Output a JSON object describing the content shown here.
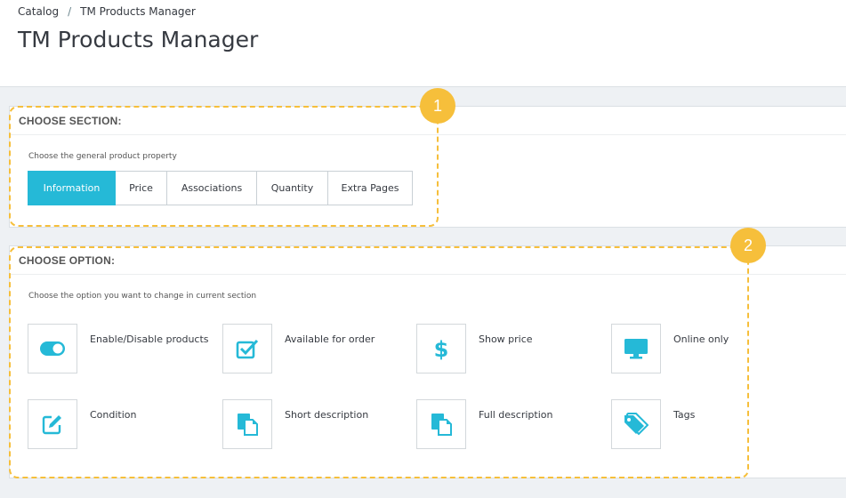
{
  "breadcrumb": {
    "root": "Catalog",
    "separator": "/",
    "current": "TM Products Manager"
  },
  "page_title": "TM Products Manager",
  "section_panel": {
    "heading": "CHOOSE SECTION:",
    "hint": "Choose the general product property",
    "buttons": [
      {
        "label": "Information",
        "active": true
      },
      {
        "label": "Price",
        "active": false
      },
      {
        "label": "Associations",
        "active": false
      },
      {
        "label": "Quantity",
        "active": false
      },
      {
        "label": "Extra Pages",
        "active": false
      }
    ]
  },
  "option_panel": {
    "heading": "CHOOSE OPTION:",
    "hint": "Choose the option you want to change in current section",
    "options": [
      {
        "label": "Enable/Disable products",
        "icon": "toggle-icon"
      },
      {
        "label": "Available for order",
        "icon": "checkbox-icon"
      },
      {
        "label": "Show price",
        "icon": "dollar-icon"
      },
      {
        "label": "Online only",
        "icon": "monitor-icon"
      },
      {
        "label": "Condition",
        "icon": "edit-icon"
      },
      {
        "label": "Short description",
        "icon": "document-icon"
      },
      {
        "label": "Full description",
        "icon": "document-icon"
      },
      {
        "label": "Tags",
        "icon": "tags-icon"
      }
    ]
  },
  "callouts": [
    "1",
    "2"
  ],
  "colors": {
    "accent": "#25b9d7",
    "callout": "#f6bf3b"
  }
}
